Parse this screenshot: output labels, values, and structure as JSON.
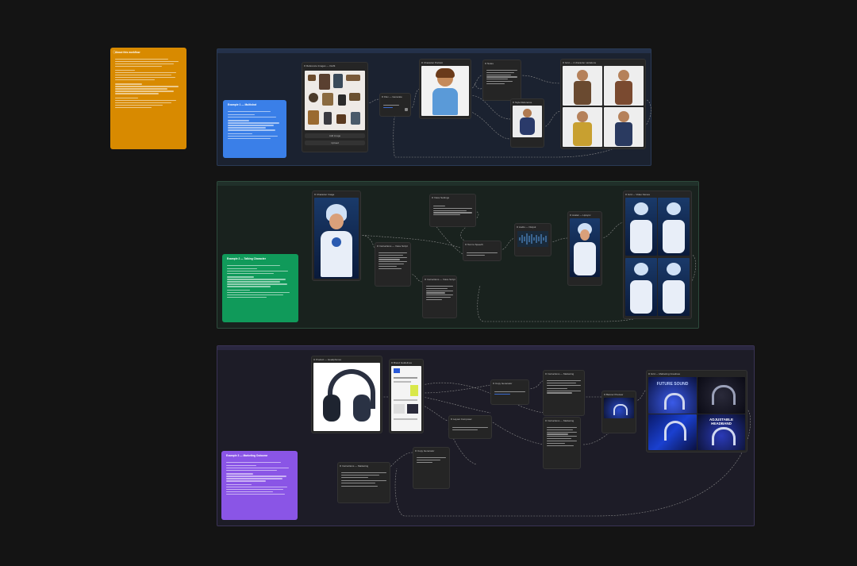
{
  "canvas": {
    "background": "#141414"
  },
  "colors": {
    "orange_note": "#d88a00",
    "blue_note": "#3a7fe8",
    "green_note": "#109a5a",
    "purple_note": "#8a55e6",
    "group1_border": "#2a3a55",
    "group2_border": "#2d4a3c",
    "group3_border": "#3a3355",
    "wire": "#8a8a8a"
  },
  "about_note": {
    "title": "About this workflow",
    "icon": "info-icon"
  },
  "examples": [
    {
      "title": "Example 1 — Multishot"
    },
    {
      "title": "Example 2 — Talking Character"
    },
    {
      "title": "Example 3 — Marketing Outcome"
    }
  ],
  "group1": {
    "nodes": {
      "reference_images": "Reference Images — Outfit",
      "gen_prompt": "Flux — Generate",
      "portrait": "Character Portrait",
      "notes": "Notes",
      "style_ref": "Style Reference",
      "output_grid": "Grid — 4 character variations"
    },
    "buttons": [
      "Add image",
      "Upload"
    ]
  },
  "group2": {
    "nodes": {
      "character": "Character Image",
      "script": "Instructions — Voice Script",
      "speech": "Text to Speech",
      "tts_params": "Voice Settings",
      "audio": "Audio — Output",
      "avatar": "Avatar — Lipsync",
      "output_grid": "Grid — Video frames"
    }
  },
  "group3": {
    "nodes": {
      "product": "Product — Headphones",
      "brand": "Brand Guidelines",
      "instructions": "Instructions — Marketing",
      "compose": "Layout Composer",
      "copy": "Copy Generator",
      "banner": "Banner Preview",
      "output_grid": "Grid — Marketing Creatives"
    },
    "banners": [
      "FUTURE SOUND",
      "ADJUSTABLE HEADBAND"
    ]
  }
}
